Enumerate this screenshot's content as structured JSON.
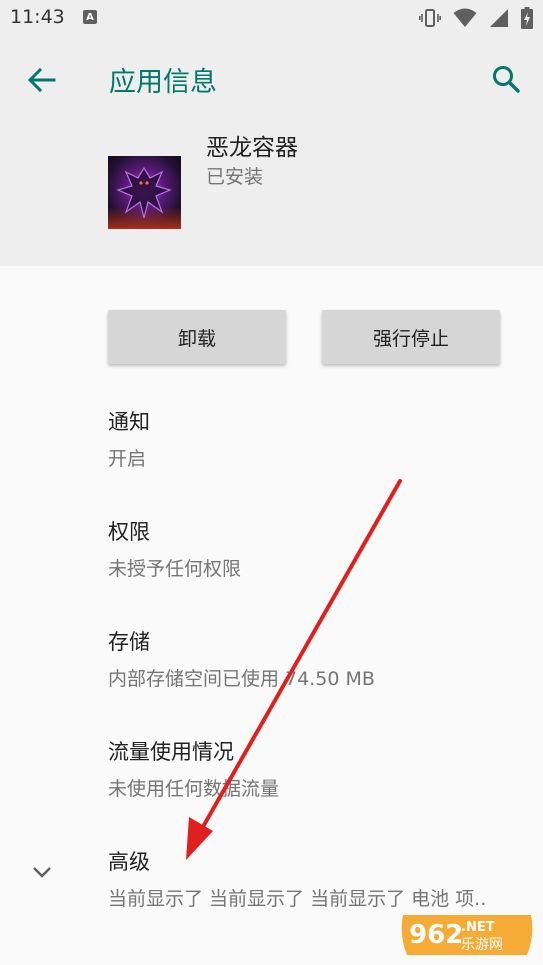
{
  "status_bar": {
    "time": "11:43",
    "notification_badge": "A",
    "icons": [
      "vibrate-icon",
      "wifi-icon",
      "signal-icon",
      "battery-charging-icon"
    ]
  },
  "header": {
    "title": "应用信息",
    "back_icon": "back-arrow-icon",
    "search_icon": "search-icon"
  },
  "app": {
    "name": "恶龙容器",
    "status": "已安装"
  },
  "buttons": {
    "uninstall": "卸载",
    "force_stop": "强行停止"
  },
  "items": [
    {
      "title": "通知",
      "subtitle": "开启"
    },
    {
      "title": "权限",
      "subtitle": "未授予任何权限"
    },
    {
      "title": "存储",
      "subtitle": "内部存储空间已使用 74.50 MB"
    },
    {
      "title": "流量使用情况",
      "subtitle": "未使用任何数据流量"
    },
    {
      "title": "高级",
      "subtitle": "当前显示了 当前显示了 当前显示了 电池 项.."
    }
  ],
  "watermark": {
    "number": "962",
    "suffix": ".NET",
    "text": "乐游网"
  },
  "colors": {
    "accent": "#00796b",
    "annotation_arrow": "#e0201f",
    "header_bg": "#eeeeee",
    "page_bg": "#fafafa"
  }
}
